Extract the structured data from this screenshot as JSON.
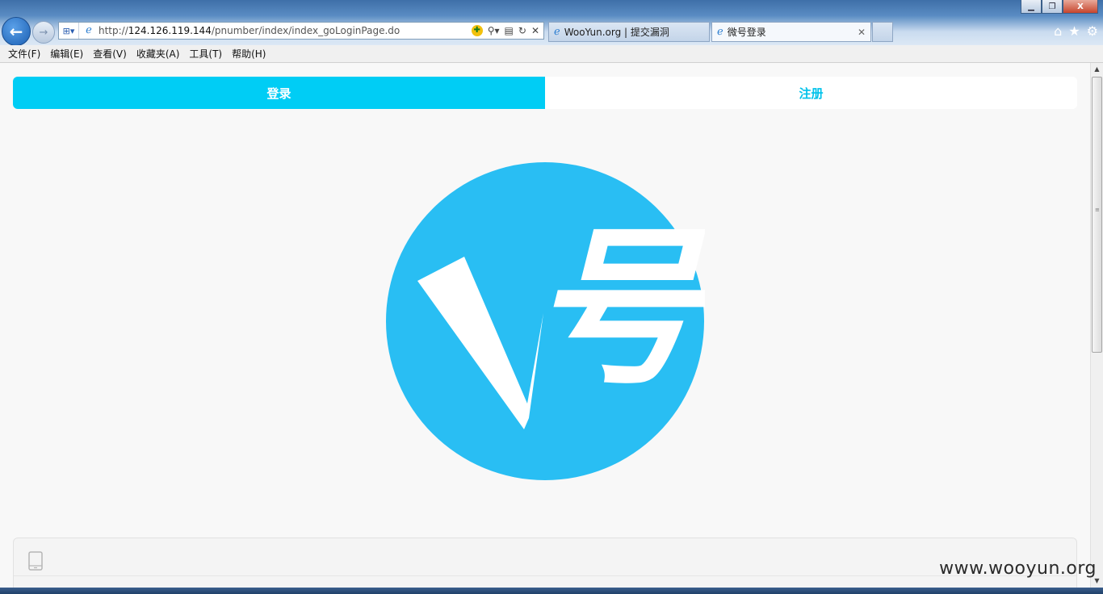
{
  "browser": {
    "address_url_prefix": "http://",
    "address_url_host": "124.126.119.144",
    "address_url_path": "/pnumber/index/index_goLoginPage.do",
    "tabs": [
      {
        "title": "WooYun.org | 提交漏洞"
      },
      {
        "title": "微号登录"
      }
    ],
    "window_controls": {
      "minimize": "▁",
      "restore": "❐",
      "close": "X"
    },
    "menu": [
      "文件(F)",
      "编辑(E)",
      "查看(V)",
      "收藏夹(A)",
      "工具(T)",
      "帮助(H)"
    ]
  },
  "page": {
    "tabs": {
      "login": "登录",
      "register": "注册"
    },
    "logo": {
      "letter": "V",
      "character": "号",
      "bg_color": "#29bef3"
    },
    "accent_color": "#00cdf5"
  },
  "watermark": "www.wooyun.org"
}
